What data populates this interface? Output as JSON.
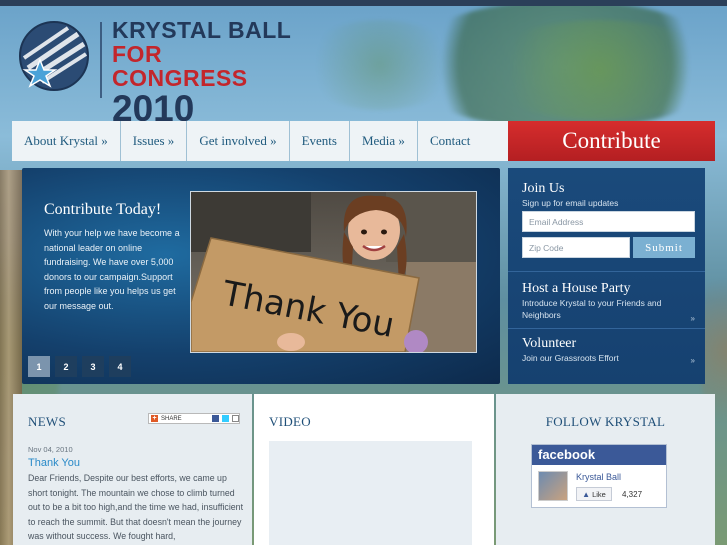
{
  "header": {
    "logo_line1": "KRYSTAL BALL",
    "logo_line2": "FOR CONGRESS",
    "logo_line3": "2010"
  },
  "nav": {
    "items": [
      {
        "label": "About Krystal »"
      },
      {
        "label": "Issues »"
      },
      {
        "label": "Get involved »"
      },
      {
        "label": "Events"
      },
      {
        "label": "Media »"
      },
      {
        "label": "Contact"
      }
    ],
    "contribute_label": "Contribute"
  },
  "promo": {
    "title": "Contribute Today!",
    "body": "With your help we have become a national leader on online fundraising. We have over 5,000 donors to our campaign.Support from people like you helps us get our message out.",
    "photo_sign_text": "Thank You",
    "pages": [
      "1",
      "2",
      "3",
      "4"
    ],
    "active_page": "1"
  },
  "sidebar": {
    "join": {
      "heading": "Join Us",
      "sub": "Sign up for email updates",
      "email_placeholder": "Email Address",
      "zip_placeholder": "Zip Code",
      "submit_label": "Submit"
    },
    "house_party": {
      "heading": "Host a House Party",
      "sub": "Introduce Krystal to your Friends and Neighbors",
      "arrow": "»"
    },
    "volunteer": {
      "heading": "Volunteer",
      "sub": "Join our Grassroots Effort",
      "arrow": "»"
    }
  },
  "news": {
    "heading": "NEWS",
    "share_label": "SHARE",
    "date": "Nov 04, 2010",
    "title": "Thank You",
    "body": "Dear Friends, Despite our best efforts, we came up short tonight. The mountain we chose to climb turned out to be a bit too high,and the time we had, insufficient to reach the summit. But that doesn't mean the journey was without success. We fought hard,"
  },
  "video": {
    "heading": "VIDEO"
  },
  "follow": {
    "heading": "FOLLOW KRYSTAL",
    "fb_brand": "facebook",
    "fb_name": "Krystal Ball",
    "fb_like_label": "Like",
    "fb_count": "4,327"
  },
  "colors": {
    "brand_navy": "#23395a",
    "brand_red": "#c3262c",
    "nav_text": "#1f5a7e",
    "link_blue": "#2a8ac8",
    "facebook": "#3b5998"
  }
}
